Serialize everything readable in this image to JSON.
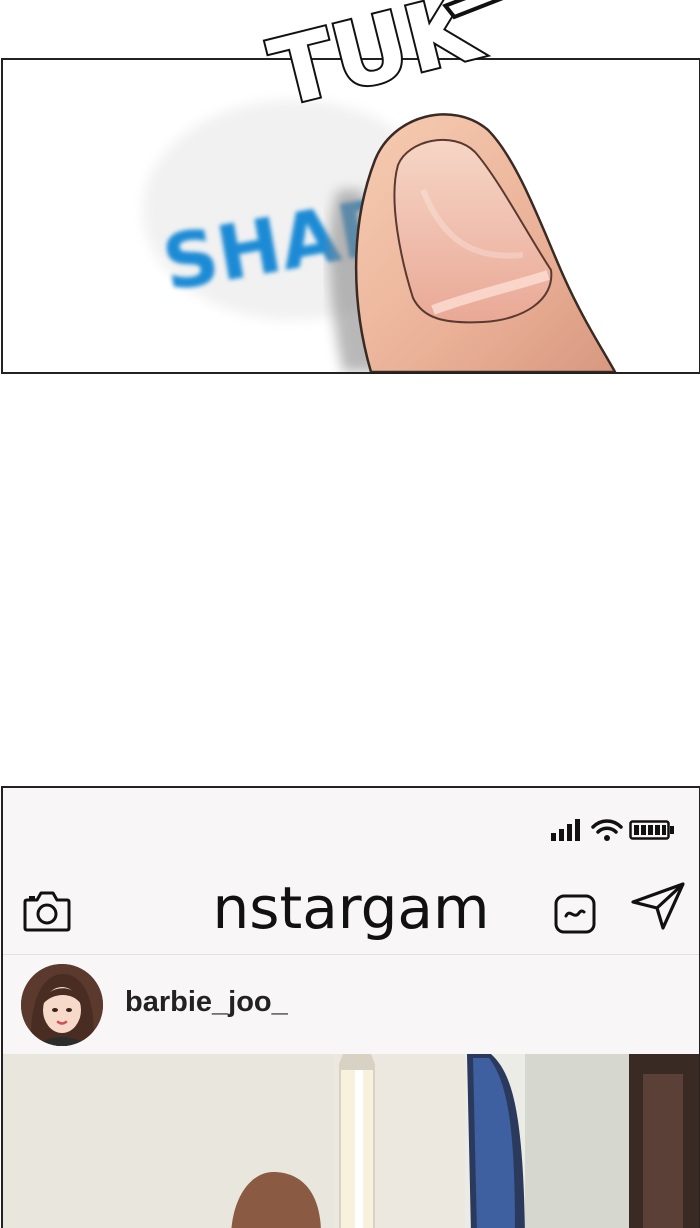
{
  "sfx": {
    "text": "TUK"
  },
  "panel_top": {
    "screen_text": "SHAR"
  },
  "phone": {
    "status": {
      "signal_icon": "signal-bars-icon",
      "wifi_icon": "wifi-icon",
      "battery_icon": "battery-full-icon"
    },
    "app_title": "nstargam",
    "icons": {
      "camera": "camera-icon",
      "tv": "igtv-icon",
      "send": "direct-message-icon"
    },
    "post": {
      "username": "barbie_joo_"
    }
  }
}
